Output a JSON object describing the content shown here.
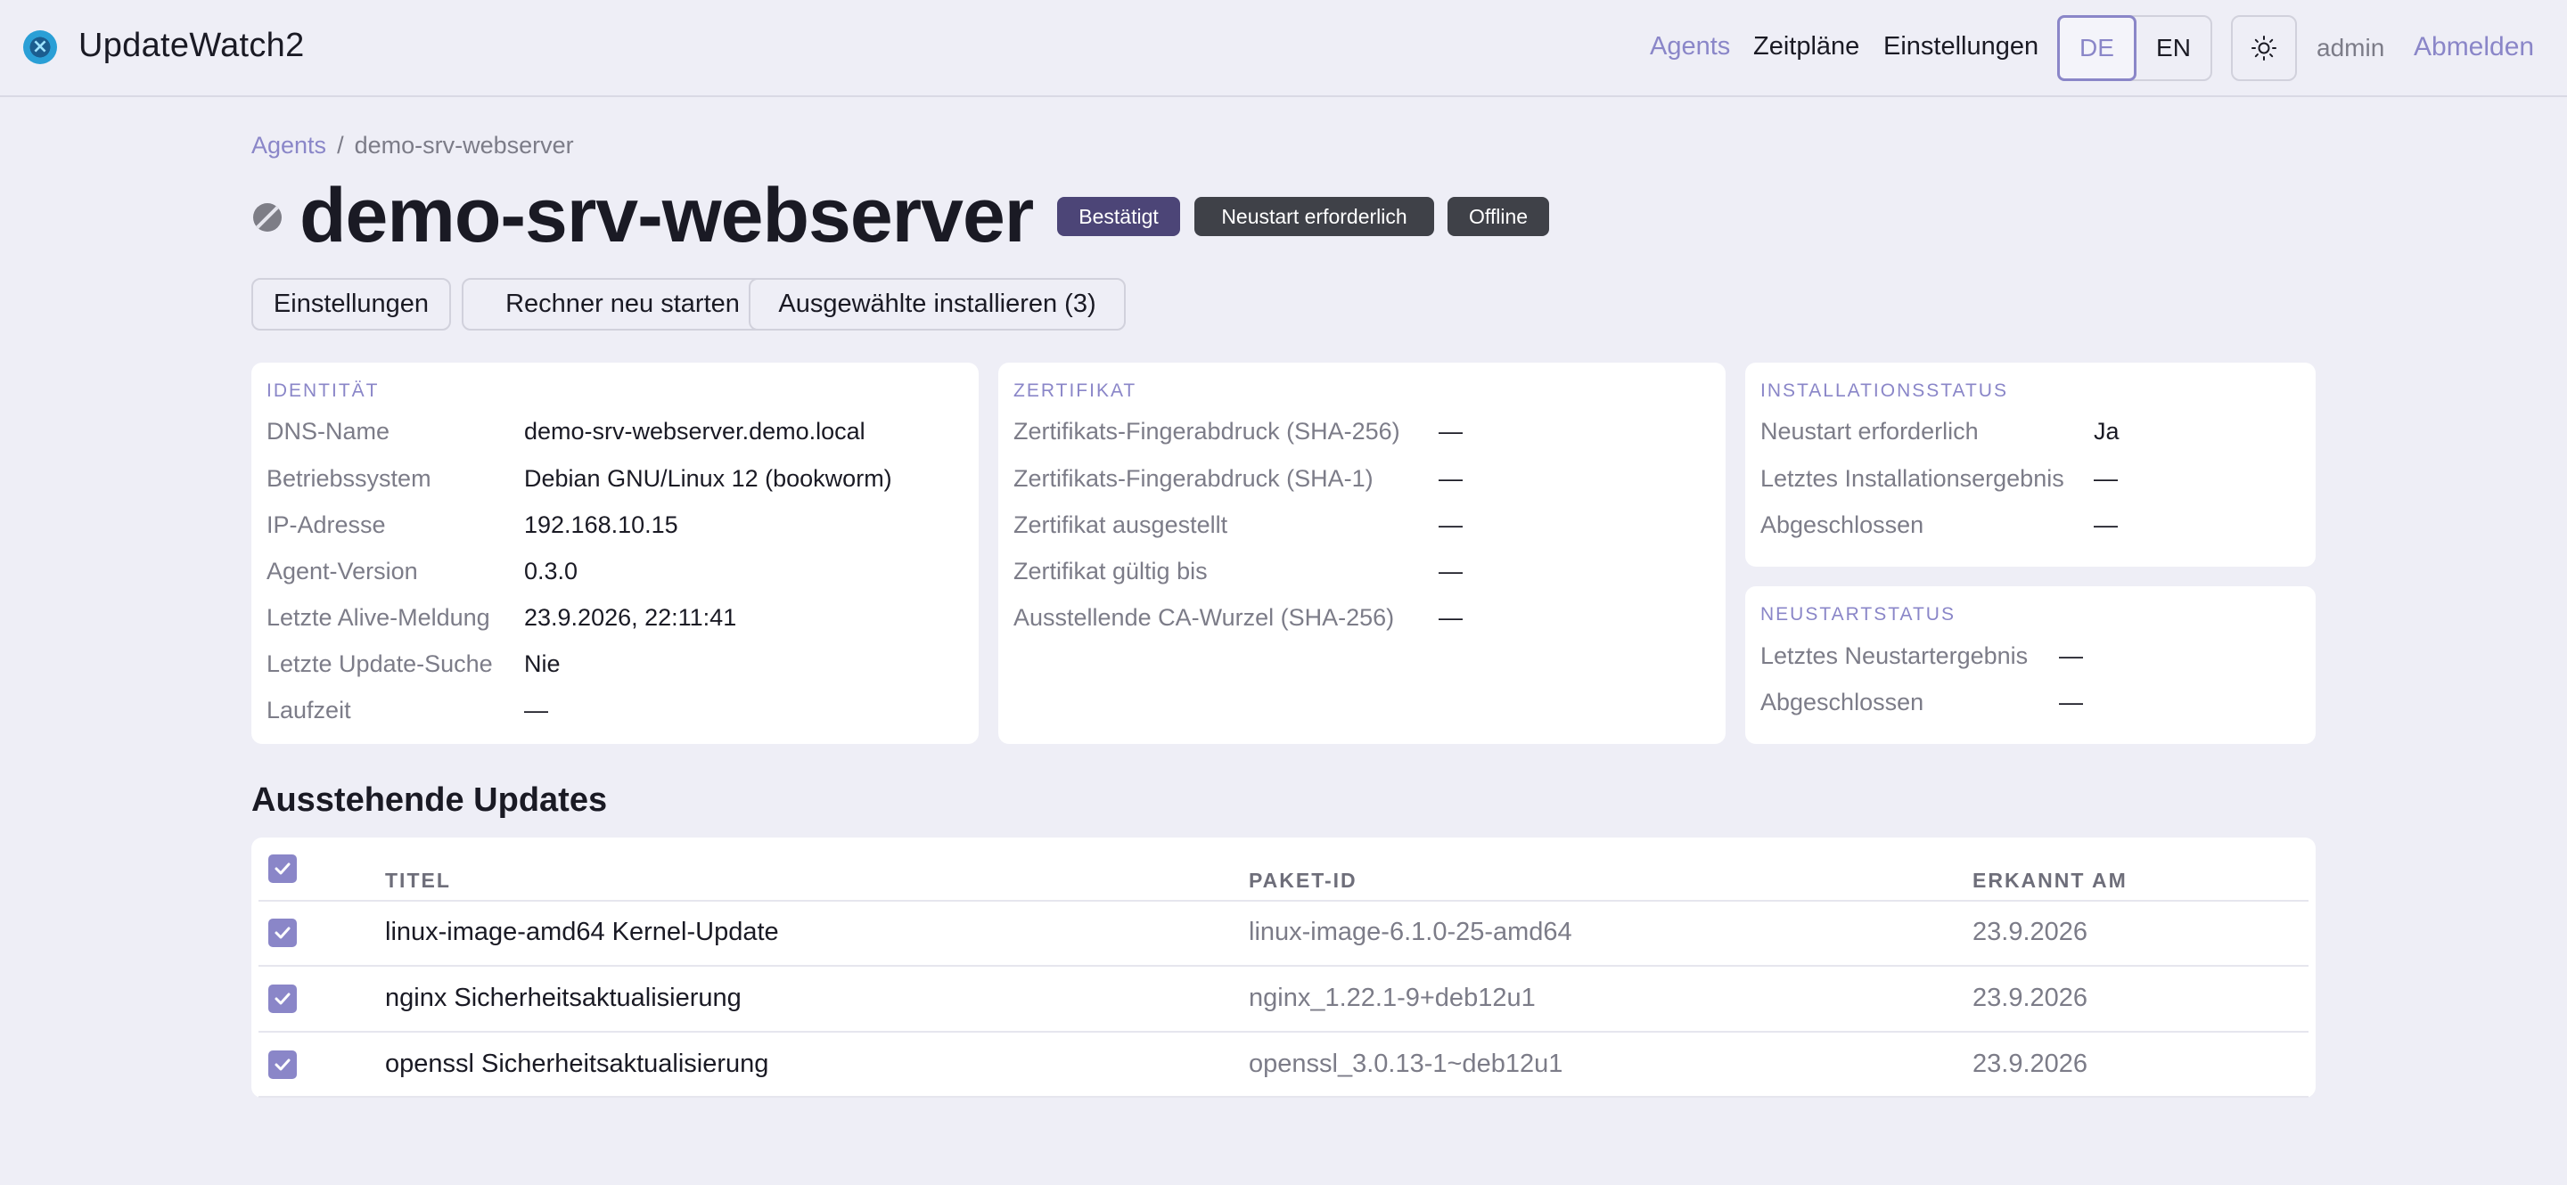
{
  "app": {
    "brand": "UpdateWatch2",
    "nav": {
      "agents": "Agents",
      "schedules": "Zeitpläne",
      "settings": "Einstellungen"
    },
    "languages": [
      "DE",
      "EN"
    ],
    "active_language": "DE",
    "user": "admin",
    "logout": "Abmelden",
    "accent_color": "#8a86c8"
  },
  "breadcrumb": {
    "root": "Agents",
    "separator": "/",
    "current": "demo-srv-webserver"
  },
  "agent": {
    "name": "demo-srv-webserver",
    "status_icon": "offline-status-icon",
    "badges": {
      "confirmed": "Bestätigt",
      "reboot": "Neustart erforderlich",
      "offline": "Offline"
    }
  },
  "actions": {
    "settings": "Einstellungen",
    "restart": "Rechner neu starten",
    "install_selected": "Ausgewählte installieren (3)"
  },
  "identity": {
    "heading": "IDENTITÄT",
    "rows": [
      {
        "label": "DNS-Name",
        "value": "demo-srv-webserver.demo.local"
      },
      {
        "label": "Betriebssystem",
        "value": "Debian GNU/Linux 12 (bookworm)"
      },
      {
        "label": "IP-Adresse",
        "value": "192.168.10.15"
      },
      {
        "label": "Agent-Version",
        "value": "0.3.0"
      },
      {
        "label": "Letzte Alive-Meldung",
        "value": "23.9.2026, 22:11:41"
      },
      {
        "label": "Letzte Update-Suche",
        "value": "Nie"
      },
      {
        "label": "Laufzeit",
        "value": "—"
      }
    ]
  },
  "certificate": {
    "heading": "ZERTIFIKAT",
    "rows": [
      {
        "label": "Zertifikats-Fingerabdruck (SHA-256)",
        "value": "—"
      },
      {
        "label": "Zertifikats-Fingerabdruck (SHA-1)",
        "value": "—"
      },
      {
        "label": "Zertifikat ausgestellt",
        "value": "—"
      },
      {
        "label": "Zertifikat gültig bis",
        "value": "—"
      },
      {
        "label": "Ausstellende CA-Wurzel (SHA-256)",
        "value": "—"
      }
    ]
  },
  "install_status": {
    "heading": "INSTALLATIONSSTATUS",
    "rows": [
      {
        "label": "Neustart erforderlich",
        "value": "Ja"
      },
      {
        "label": "Letztes Installationsergebnis",
        "value": "—"
      },
      {
        "label": "Abgeschlossen",
        "value": "—"
      }
    ]
  },
  "reboot_status": {
    "heading": "NEUSTARTSTATUS",
    "rows": [
      {
        "label": "Letztes Neustartergebnis",
        "value": "—"
      },
      {
        "label": "Abgeschlossen",
        "value": "—"
      }
    ]
  },
  "updates": {
    "title": "Ausstehende Updates",
    "columns": {
      "title": "TITEL",
      "package": "PAKET-ID",
      "detected": "ERKANNT AM"
    },
    "all_selected": true,
    "rows": [
      {
        "title": "linux-image-amd64 Kernel-Update",
        "package": "linux-image-6.1.0-25-amd64",
        "detected": "23.9.2026",
        "selected": true
      },
      {
        "title": "nginx Sicherheitsaktualisierung",
        "package": "nginx_1.22.1-9+deb12u1",
        "detected": "23.9.2026",
        "selected": true
      },
      {
        "title": "openssl Sicherheitsaktualisierung",
        "package": "openssl_3.0.13-1~deb12u1",
        "detected": "23.9.2026",
        "selected": true
      }
    ]
  }
}
